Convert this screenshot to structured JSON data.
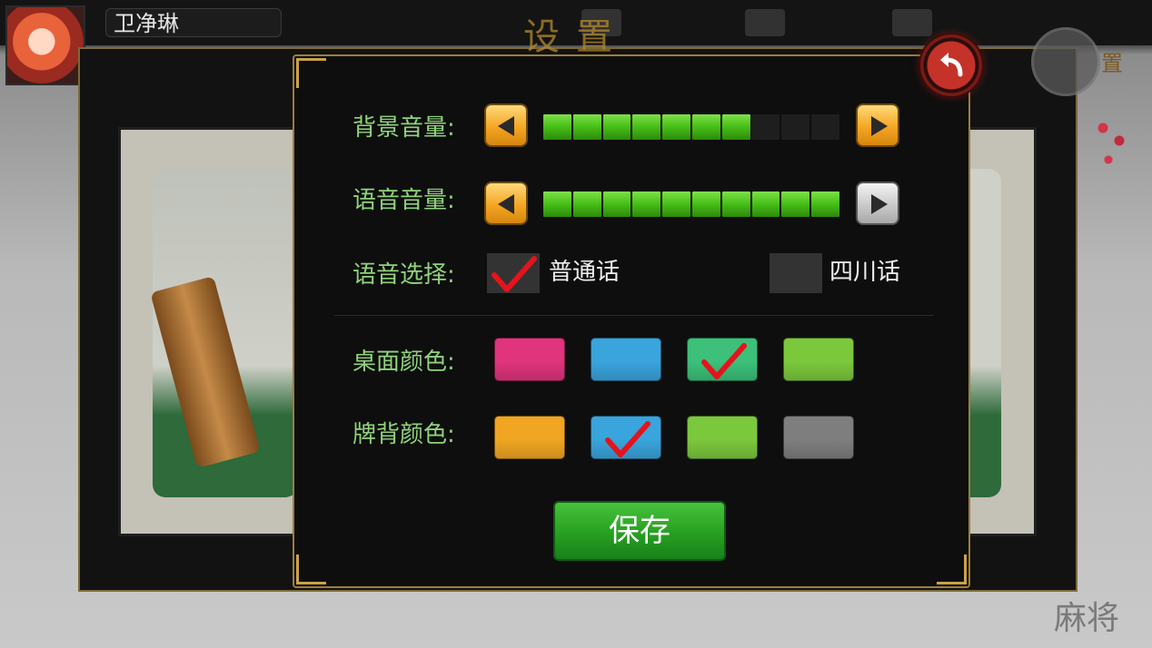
{
  "user": {
    "name": "卫净琳"
  },
  "background": {
    "title_glyphs": "设置",
    "back_label": "置"
  },
  "settings": {
    "bg_volume": {
      "label": "背景音量:",
      "level": 7,
      "max": 10
    },
    "voice_volume": {
      "label": "语音音量:",
      "level": 10,
      "max": 10
    },
    "voice_select": {
      "label": "语音选择:",
      "options": [
        {
          "label": "普通话",
          "checked": true
        },
        {
          "label": "四川话",
          "checked": false
        }
      ]
    },
    "table_color": {
      "label": "桌面颜色:",
      "swatches": [
        "#e0347c",
        "#3aa4dc",
        "#3cc07a",
        "#7cc83c"
      ],
      "selected": 2
    },
    "tile_back_color": {
      "label": "牌背颜色:",
      "swatches": [
        "#f0a623",
        "#3aa4dc",
        "#7cc83c",
        "#7e7e7e"
      ],
      "selected": 1
    },
    "save_label": "保存"
  },
  "icons": [
    "back-arrow-icon",
    "left-arrow-icon",
    "right-arrow-icon",
    "checkmark-icon"
  ]
}
